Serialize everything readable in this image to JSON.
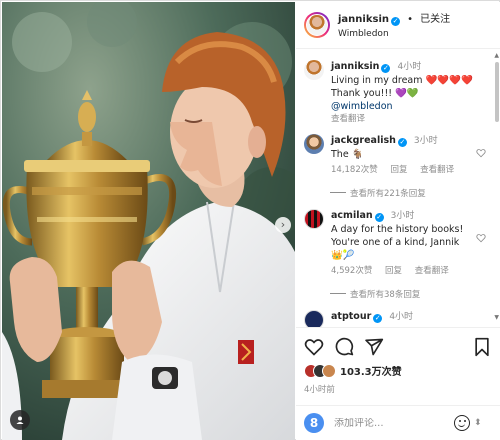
{
  "post": {
    "username": "janniksin",
    "follow_status": "已关注",
    "separator": "•",
    "location": "Wimbledon"
  },
  "caption": {
    "username": "janniksin",
    "time": "4小时",
    "line1": "Living in my dream ❤️❤️❤️❤️",
    "line2": "Thank you!!! 💜💚",
    "mention": "@wimbledon",
    "translate": "查看翻译"
  },
  "comments": [
    {
      "username": "jackgrealish",
      "time": "3小时",
      "text": "The 🐐",
      "likes": "14,182次赞",
      "reply": "回复",
      "translate": "查看翻译",
      "view_replies": "查看所有221条回复"
    },
    {
      "username": "acmilan",
      "time": "3小时",
      "text": "A day for the history books! You're one of a kind, Jannik 👑🎾",
      "likes": "4,592次赞",
      "reply": "回复",
      "translate": "查看翻译",
      "view_replies": "查看所有38条回复"
    },
    {
      "username": "atptour",
      "time": "4小时"
    }
  ],
  "actions": {
    "likes_count": "103.3万次赞",
    "posted_time": "4小时前"
  },
  "add_comment": {
    "placeholder": "添加评论...",
    "avatar_letter": "8"
  },
  "icons": [
    "heart-icon",
    "comment-icon",
    "share-icon",
    "bookmark-icon",
    "verified-icon",
    "emoji-icon",
    "carousel-icon"
  ],
  "colors": {
    "verified": "#0095f6",
    "secondary_text": "#8e8e8e",
    "mention": "#00376b"
  }
}
